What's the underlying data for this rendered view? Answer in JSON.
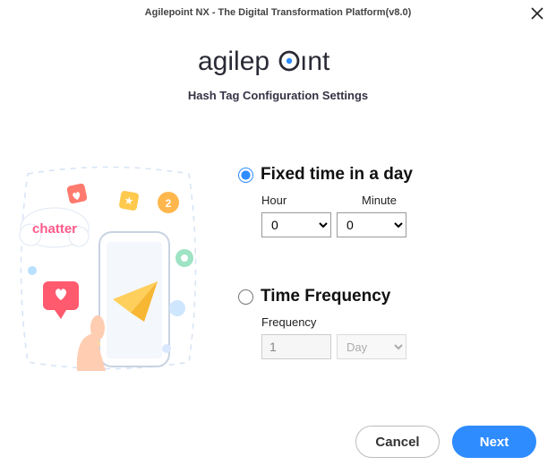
{
  "window": {
    "title": "Agilepoint NX - The Digital Transformation Platform(v8.0)"
  },
  "header": {
    "subtitle": "Hash Tag Configuration Settings",
    "logo_text": "agilepoint"
  },
  "form": {
    "fixed_time": {
      "label": "Fixed time in a day",
      "selected": true,
      "hour_label": "Hour",
      "minute_label": "Minute",
      "hour_value": "0",
      "minute_value": "0"
    },
    "time_frequency": {
      "label": "Time Frequency",
      "selected": false,
      "frequency_label": "Frequency",
      "frequency_value": "1",
      "unit_value": "Day"
    }
  },
  "footer": {
    "cancel": "Cancel",
    "next": "Next"
  },
  "illustration": {
    "badge_text": "chatter"
  }
}
